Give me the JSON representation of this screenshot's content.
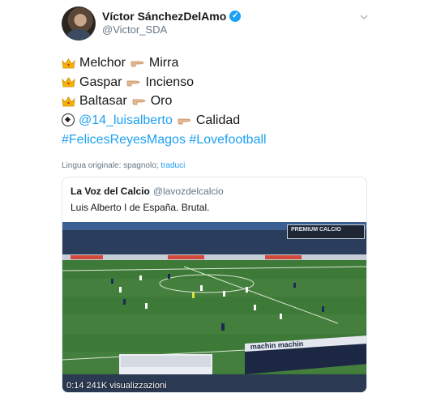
{
  "tweet": {
    "author": {
      "display_name": "Víctor SánchezDelAmo",
      "handle": "@Victor_SDA",
      "verified": true
    },
    "lines": [
      {
        "left": "Melchor",
        "right": "Mirra"
      },
      {
        "left": "Gaspar",
        "right": "Incienso"
      },
      {
        "left": "Baltasar",
        "right": "Oro"
      }
    ],
    "mention_line": {
      "mention": "@14_luisalberto",
      "right": "Calidad"
    },
    "hashtags": "#FelicesReyesMagos #Lovefootball",
    "language": {
      "label": "Lingua originale: spagnolo;",
      "translate_link": "traduci"
    },
    "icons": {
      "crown": "crown-emoji",
      "pointing_hand": "backhand-index-pointing-right-emoji",
      "ball": "soccer-ball-emoji",
      "verified": "verified-badge-icon",
      "menu": "chevron-down-icon"
    }
  },
  "quoted_tweet": {
    "display_name": "La Voz del Calcio",
    "handle": "@lavozdelcalcio",
    "text": "Luis Alberto I de España. Brutal.",
    "video": {
      "timestamp": "0:14  241K visualizzazioni",
      "broadcast_tag": "PREMIUM CALCIO",
      "banner_text": "machin machin"
    }
  },
  "colors": {
    "link": "#1da1f2",
    "secondary_text": "#657786",
    "pitch": "#3a6a34"
  }
}
